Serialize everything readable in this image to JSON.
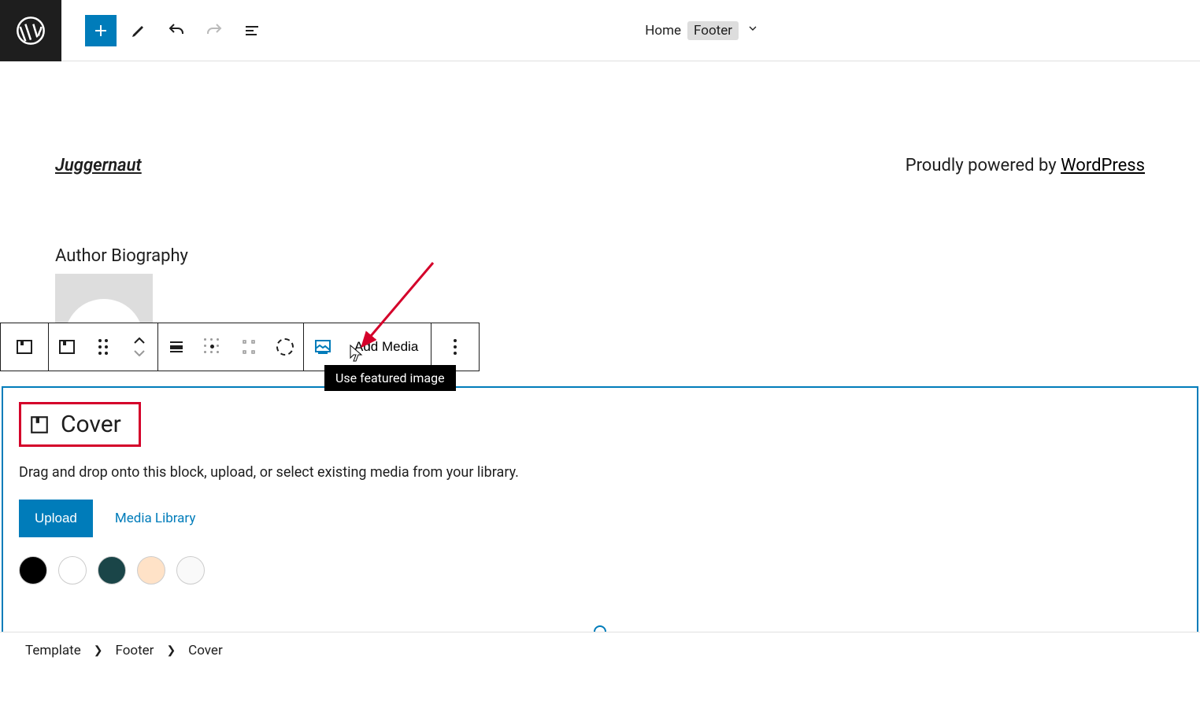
{
  "header": {
    "home_label": "Home",
    "template_part_label": "Footer"
  },
  "footer_content": {
    "site_title": "Juggernaut",
    "powered_prefix": "Proudly powered by ",
    "powered_link": "WordPress"
  },
  "author_section": {
    "heading": "Author Biography"
  },
  "block_toolbar": {
    "add_media_label": "Add Media",
    "tooltip": "Use featured image"
  },
  "cover_block": {
    "title": "Cover",
    "description": "Drag and drop onto this block, upload, or select existing media from your library.",
    "upload_label": "Upload",
    "media_library_label": "Media Library",
    "swatch_colors": [
      "#000000",
      "#ffffff",
      "#1a4548",
      "#ffe2c7",
      "#f9f9f9"
    ]
  },
  "breadcrumb": {
    "items": [
      "Template",
      "Footer",
      "Cover"
    ]
  }
}
